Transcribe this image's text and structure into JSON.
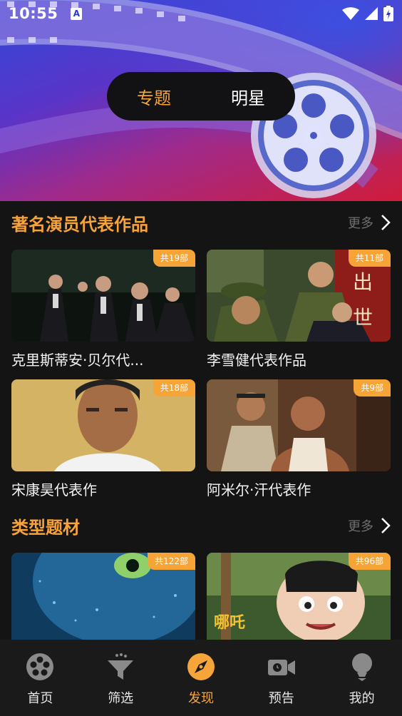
{
  "status_bar": {
    "time": "10:55",
    "notification_letter": "A"
  },
  "hero": {
    "tabs": [
      {
        "label": "专题",
        "active": true
      },
      {
        "label": "明星",
        "active": false
      }
    ]
  },
  "sections": [
    {
      "title": "著名演员代表作品",
      "more_label": "更多",
      "items": [
        {
          "title": "克里斯蒂安·贝尔代...",
          "badge": "共19部"
        },
        {
          "title": "李雪健代表作品",
          "badge": "共11部"
        },
        {
          "title": "宋康昊代表作",
          "badge": "共18部"
        },
        {
          "title": "阿米尔·汗代表作",
          "badge": "共9部"
        }
      ]
    },
    {
      "title": "类型题材",
      "more_label": "更多",
      "items": [
        {
          "title": "",
          "badge": "共122部"
        },
        {
          "title": "",
          "badge": "共96部"
        }
      ]
    }
  ],
  "bottom_nav": [
    {
      "label": "首页",
      "icon": "film-reel-icon",
      "active": false
    },
    {
      "label": "筛选",
      "icon": "funnel-icon",
      "active": false
    },
    {
      "label": "发现",
      "icon": "compass-icon",
      "active": true
    },
    {
      "label": "预告",
      "icon": "video-camera-icon",
      "active": false
    },
    {
      "label": "我的",
      "icon": "profile-icon",
      "active": false
    }
  ],
  "colors": {
    "accent": "#f5a53a",
    "background": "#141414",
    "nav_bg": "#1a1a1a",
    "muted": "#6e6e6e"
  }
}
